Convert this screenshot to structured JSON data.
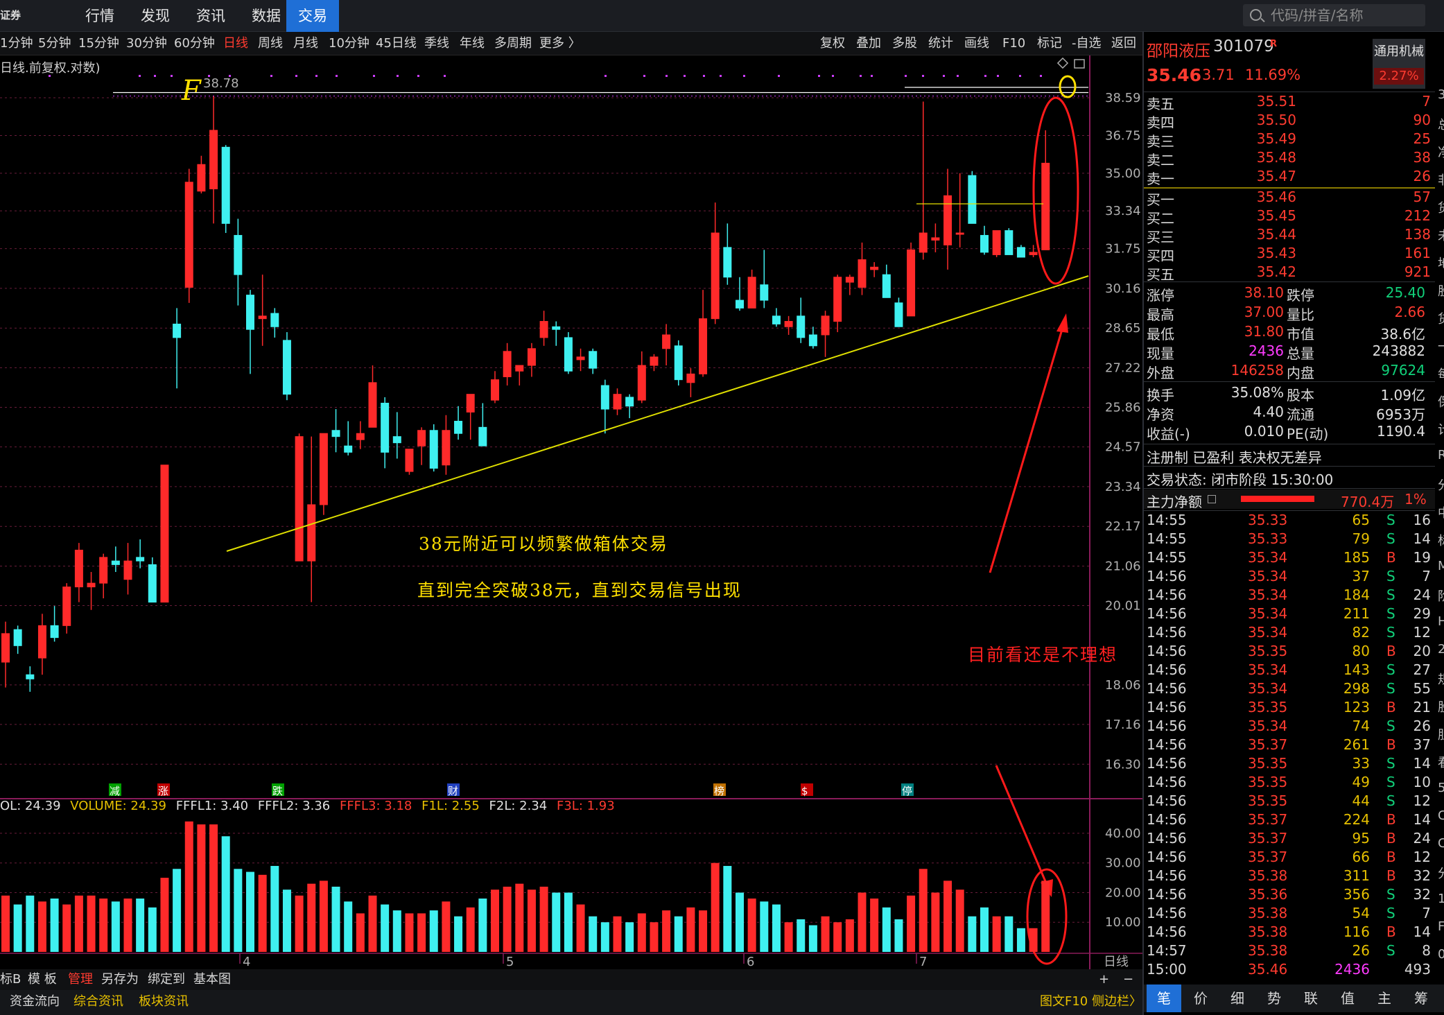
{
  "nav": {
    "logo": "证券",
    "items": [
      "行情",
      "发现",
      "资讯",
      "数据",
      "交易"
    ],
    "active": "交易",
    "search_placeholder": "代码/拼音/名称"
  },
  "toolbar": {
    "periods": [
      "1分钟",
      "5分钟",
      "15分钟",
      "30分钟",
      "60分钟",
      "日线",
      "周线",
      "月线",
      "10分钟",
      "45日线",
      "季线",
      "年线",
      "多周期",
      "更多 〉"
    ],
    "active_period": "日线",
    "tools": [
      "复权",
      "叠加",
      "多股",
      "统计",
      "画线",
      "F10",
      "标记",
      "-自选",
      "返回"
    ]
  },
  "chart": {
    "title": "日线.前复权.对数)",
    "high_label": "38.78",
    "y_ticks": [
      "38.59",
      "36.75",
      "35.00",
      "33.34",
      "31.75",
      "30.16",
      "28.65",
      "27.22",
      "25.86",
      "24.57",
      "23.34",
      "22.17",
      "21.06",
      "20.01",
      "18.06",
      "17.16",
      "16.30"
    ],
    "event_markers": [
      {
        "label": "减",
        "color": "#00a000"
      },
      {
        "label": "涨",
        "color": "#c00000"
      },
      {
        "label": "跌",
        "color": "#00a000"
      },
      {
        "label": "财",
        "color": "#2040c0"
      },
      {
        "label": "榜",
        "color": "#c07000"
      },
      {
        "label": "$",
        "color": "#c00000"
      },
      {
        "label": "停",
        "color": "#008080"
      }
    ],
    "month_labels": [
      "4",
      "5",
      "6",
      "7"
    ],
    "period_label": "日线"
  },
  "chart_data": {
    "type": "candlestick",
    "ylim": [
      16.0,
      39.5
    ],
    "y_scale": "log",
    "candles": [
      [
        18.6,
        19.6,
        18.0,
        19.3
      ],
      [
        19.4,
        19.5,
        18.8,
        19.0
      ],
      [
        18.3,
        18.5,
        17.9,
        18.2
      ],
      [
        18.7,
        19.8,
        18.3,
        19.5
      ],
      [
        19.5,
        20.0,
        19.1,
        19.2
      ],
      [
        19.5,
        20.6,
        19.3,
        20.5
      ],
      [
        20.5,
        21.7,
        20.1,
        21.5
      ],
      [
        20.5,
        20.9,
        19.9,
        20.6
      ],
      [
        20.6,
        21.4,
        20.2,
        21.3
      ],
      [
        21.2,
        21.6,
        20.9,
        21.1
      ],
      [
        20.7,
        21.7,
        20.3,
        21.2
      ],
      [
        21.3,
        21.8,
        21.0,
        21.2
      ],
      [
        21.1,
        21.3,
        20.1,
        20.1
      ],
      [
        20.1,
        24.0,
        20.1,
        24.0
      ],
      [
        28.8,
        29.4,
        26.5,
        28.3
      ],
      [
        30.2,
        35.2,
        29.6,
        34.6
      ],
      [
        34.2,
        35.8,
        34.1,
        35.4
      ],
      [
        34.3,
        38.7,
        32.8,
        37.0
      ],
      [
        36.2,
        36.3,
        32.4,
        32.8
      ],
      [
        32.3,
        33.0,
        29.5,
        30.7
      ],
      [
        29.9,
        30.1,
        27.0,
        28.6
      ],
      [
        29.0,
        30.7,
        28.0,
        29.1
      ],
      [
        29.2,
        29.4,
        28.3,
        28.7
      ],
      [
        28.2,
        28.5,
        26.1,
        26.3
      ],
      [
        21.2,
        25.0,
        21.2,
        24.9
      ],
      [
        21.2,
        24.9,
        20.1,
        22.8
      ],
      [
        22.8,
        25.0,
        22.5,
        25.0
      ],
      [
        25.1,
        25.8,
        24.4,
        24.9
      ],
      [
        24.6,
        25.4,
        24.3,
        24.4
      ],
      [
        24.8,
        25.4,
        24.5,
        25.0
      ],
      [
        25.2,
        27.3,
        25.2,
        26.7
      ],
      [
        26.0,
        26.2,
        23.9,
        24.4
      ],
      [
        24.9,
        25.7,
        24.2,
        24.7
      ],
      [
        23.8,
        24.5,
        23.7,
        24.5
      ],
      [
        24.6,
        25.2,
        24.0,
        25.1
      ],
      [
        25.1,
        25.3,
        23.8,
        23.9
      ],
      [
        24.0,
        25.6,
        23.7,
        25.1
      ],
      [
        25.4,
        25.9,
        24.8,
        25.0
      ],
      [
        25.7,
        26.3,
        24.8,
        26.3
      ],
      [
        25.2,
        26.0,
        24.6,
        24.6
      ],
      [
        26.1,
        27.1,
        26.0,
        26.8
      ],
      [
        26.9,
        28.1,
        26.6,
        27.8
      ],
      [
        27.1,
        27.3,
        26.6,
        27.3
      ],
      [
        27.3,
        28.1,
        26.9,
        27.9
      ],
      [
        28.3,
        29.3,
        28.0,
        28.9
      ],
      [
        28.7,
        28.9,
        28.0,
        28.6
      ],
      [
        28.3,
        28.5,
        27.0,
        27.1
      ],
      [
        27.5,
        27.9,
        27.1,
        27.6
      ],
      [
        27.8,
        27.9,
        27.0,
        27.2
      ],
      [
        26.6,
        26.8,
        25.0,
        25.8
      ],
      [
        25.8,
        26.5,
        25.6,
        26.3
      ],
      [
        26.2,
        26.3,
        25.5,
        25.9
      ],
      [
        26.1,
        27.8,
        26.0,
        27.3
      ],
      [
        27.3,
        27.7,
        27.1,
        27.6
      ],
      [
        27.9,
        28.8,
        27.3,
        28.4
      ],
      [
        28.0,
        28.2,
        26.6,
        26.8
      ],
      [
        26.7,
        27.2,
        26.2,
        27.0
      ],
      [
        27.0,
        30.1,
        26.9,
        29.0
      ],
      [
        29.0,
        33.7,
        28.8,
        32.4
      ],
      [
        31.8,
        32.8,
        30.3,
        30.6
      ],
      [
        29.7,
        30.6,
        29.3,
        29.4
      ],
      [
        29.4,
        30.9,
        29.4,
        30.6
      ],
      [
        30.3,
        31.7,
        29.4,
        29.7
      ],
      [
        29.1,
        29.4,
        28.7,
        28.8
      ],
      [
        28.7,
        29.1,
        28.4,
        28.9
      ],
      [
        29.1,
        29.8,
        28.1,
        28.3
      ],
      [
        28.4,
        28.7,
        27.9,
        28.0
      ],
      [
        28.4,
        29.3,
        27.6,
        29.1
      ],
      [
        28.9,
        30.7,
        28.5,
        30.6
      ],
      [
        30.4,
        30.7,
        29.9,
        30.6
      ],
      [
        30.2,
        32.0,
        29.9,
        31.3
      ],
      [
        30.9,
        31.2,
        30.6,
        31.0
      ],
      [
        30.7,
        31.1,
        29.8,
        29.8
      ],
      [
        29.6,
        29.8,
        28.7,
        28.7
      ],
      [
        29.1,
        32.0,
        29.1,
        31.7
      ],
      [
        31.6,
        38.4,
        31.3,
        32.4
      ],
      [
        32.1,
        32.8,
        31.6,
        32.2
      ],
      [
        31.9,
        35.2,
        30.9,
        34.0
      ],
      [
        32.4,
        35.0,
        31.8,
        32.4
      ],
      [
        34.9,
        35.1,
        32.8,
        32.8
      ],
      [
        32.3,
        32.7,
        31.5,
        31.6
      ],
      [
        31.5,
        32.5,
        31.4,
        32.5
      ],
      [
        32.5,
        32.6,
        31.6,
        31.5
      ],
      [
        31.8,
        31.9,
        31.5,
        31.4
      ],
      [
        31.5,
        31.9,
        31.4,
        31.6
      ],
      [
        31.7,
        37.0,
        31.7,
        35.46
      ]
    ],
    "volume": {
      "legend": {
        "VOL": "24.39",
        "VOLUME": "24.39",
        "FFFL1": "3.40",
        "FFFL2": "3.36",
        "FFFL3": "3.18",
        "F1L": "2.55",
        "F2L": "2.34",
        "F3L": "1.93"
      },
      "y_ticks": [
        "40.00",
        "30.00",
        "20.00",
        "10.00"
      ],
      "values": [
        19,
        16,
        19,
        17,
        18,
        16,
        19,
        19,
        18,
        17,
        18,
        18,
        15,
        25,
        28,
        44,
        43,
        43,
        39,
        28,
        27,
        26,
        29,
        21,
        19,
        23,
        24,
        22,
        17,
        13,
        19,
        16,
        14,
        13,
        13,
        14,
        17,
        12,
        15,
        18,
        21,
        22,
        23,
        21,
        22,
        20,
        20,
        16,
        12,
        10,
        12,
        10,
        13,
        10,
        14,
        12,
        15,
        14,
        30,
        29,
        20,
        18,
        17,
        16,
        10,
        11,
        9,
        12,
        10,
        11,
        20,
        18,
        15,
        11,
        19,
        28,
        20,
        24,
        21,
        12,
        15,
        12,
        12,
        8,
        8,
        24
      ]
    },
    "trendline": {
      "x1_price": 22.2,
      "x2_price": 30.2
    },
    "resistance_price": 38.78
  },
  "annotations": {
    "left1": "38元附近可以频繁做箱体交易",
    "left2": "直到完全突破38元，直到交易信号出现",
    "right": "目前看还是不理想",
    "handwriting_f": "F",
    "handwriting_o": "O"
  },
  "panel": {
    "name": "邵阳液压",
    "code": "301079",
    "r_badge": "R",
    "price": "35.46",
    "change": "3.71",
    "change_pct": "11.69%",
    "sector": "通用机械",
    "sector_chg": "2.27%",
    "asks": [
      {
        "label": "卖五",
        "price": "35.51",
        "vol": "7"
      },
      {
        "label": "卖四",
        "price": "35.50",
        "vol": "90"
      },
      {
        "label": "卖三",
        "price": "35.49",
        "vol": "25"
      },
      {
        "label": "卖二",
        "price": "35.48",
        "vol": "38"
      },
      {
        "label": "卖一",
        "price": "35.47",
        "vol": "26"
      }
    ],
    "bids": [
      {
        "label": "买一",
        "price": "35.46",
        "vol": "57"
      },
      {
        "label": "买二",
        "price": "35.45",
        "vol": "212"
      },
      {
        "label": "买三",
        "price": "35.44",
        "vol": "138"
      },
      {
        "label": "买四",
        "price": "35.43",
        "vol": "161"
      },
      {
        "label": "买五",
        "price": "35.42",
        "vol": "921"
      }
    ],
    "stats": {
      "zhangting_l": "涨停",
      "zhangting": "38.10",
      "dieting_l": "跌停",
      "dieting": "25.40",
      "zuigao_l": "最高",
      "zuigao": "37.00",
      "liangbi_l": "量比",
      "liangbi": "2.66",
      "zuidi_l": "最低",
      "zuidi": "31.80",
      "shizhi_l": "市值",
      "shizhi": "38.6亿",
      "xianliang_l": "现量",
      "xianliang": "2436",
      "zongliang_l": "总量",
      "zongliang": "243882",
      "waipan_l": "外盘",
      "waipan": "146258",
      "neipan_l": "内盘",
      "neipan": "97624",
      "huanshou_l": "换手",
      "huanshou": "35.08%",
      "guben_l": "股本",
      "guben": "1.09亿",
      "jingzi_l": "净资",
      "jingzi": "4.40",
      "liutong_l": "流通",
      "liutong": "6953万",
      "shouyi_l": "收益(-)",
      "shouyi": "0.010",
      "pe_l": "PE(动)",
      "pe": "1190.4"
    },
    "info1": "注册制 已盈利 表决权无差异",
    "info2": "交易状态: 闭市阶段 15:30:00",
    "main_flow_label": "主力净额",
    "main_flow": "770.4万",
    "main_flow_pct": "1%",
    "ticks": [
      {
        "t": "14:55",
        "p": "35.33",
        "v": "65",
        "d": "S",
        "n": "16"
      },
      {
        "t": "14:55",
        "p": "35.33",
        "v": "79",
        "d": "S",
        "n": "14"
      },
      {
        "t": "14:55",
        "p": "35.34",
        "v": "185",
        "d": "B",
        "n": "19"
      },
      {
        "t": "14:56",
        "p": "35.34",
        "v": "37",
        "d": "S",
        "n": "7"
      },
      {
        "t": "14:56",
        "p": "35.34",
        "v": "184",
        "d": "S",
        "n": "24"
      },
      {
        "t": "14:56",
        "p": "35.34",
        "v": "211",
        "d": "S",
        "n": "29"
      },
      {
        "t": "14:56",
        "p": "35.34",
        "v": "82",
        "d": "S",
        "n": "12"
      },
      {
        "t": "14:56",
        "p": "35.35",
        "v": "80",
        "d": "B",
        "n": "20"
      },
      {
        "t": "14:56",
        "p": "35.34",
        "v": "143",
        "d": "S",
        "n": "27"
      },
      {
        "t": "14:56",
        "p": "35.34",
        "v": "298",
        "d": "S",
        "n": "55"
      },
      {
        "t": "14:56",
        "p": "35.35",
        "v": "123",
        "d": "B",
        "n": "21"
      },
      {
        "t": "14:56",
        "p": "35.34",
        "v": "74",
        "d": "S",
        "n": "26"
      },
      {
        "t": "14:56",
        "p": "35.37",
        "v": "261",
        "d": "B",
        "n": "37"
      },
      {
        "t": "14:56",
        "p": "35.35",
        "v": "33",
        "d": "S",
        "n": "14"
      },
      {
        "t": "14:56",
        "p": "35.35",
        "v": "49",
        "d": "S",
        "n": "10"
      },
      {
        "t": "14:56",
        "p": "35.35",
        "v": "44",
        "d": "S",
        "n": "12"
      },
      {
        "t": "14:56",
        "p": "35.37",
        "v": "224",
        "d": "B",
        "n": "14"
      },
      {
        "t": "14:56",
        "p": "35.37",
        "v": "95",
        "d": "B",
        "n": "24"
      },
      {
        "t": "14:56",
        "p": "35.37",
        "v": "66",
        "d": "B",
        "n": "12"
      },
      {
        "t": "14:56",
        "p": "35.38",
        "v": "311",
        "d": "B",
        "n": "32"
      },
      {
        "t": "14:56",
        "p": "35.36",
        "v": "356",
        "d": "S",
        "n": "32"
      },
      {
        "t": "14:56",
        "p": "35.38",
        "v": "54",
        "d": "S",
        "n": "7"
      },
      {
        "t": "14:56",
        "p": "35.38",
        "v": "116",
        "d": "B",
        "n": "14"
      },
      {
        "t": "14:57",
        "p": "35.38",
        "v": "26",
        "d": "S",
        "n": "8"
      },
      {
        "t": "15:00",
        "p": "35.46",
        "v": "2436",
        "d": "",
        "n": "493"
      }
    ],
    "edge_chars": [
      "3",
      "总",
      "净",
      "非",
      "货",
      "未",
      "地",
      "股",
      "货",
      "一",
      "每",
      "保",
      "计",
      "R",
      "分",
      "中",
      "标",
      "M",
      "阶",
      "H",
      "2",
      "规",
      "股",
      "胆",
      "看",
      "5",
      "C",
      "C",
      "分",
      "1",
      "F",
      "0"
    ],
    "tabs": [
      "笔",
      "价",
      "细",
      "势",
      "联",
      "值",
      "主",
      "筹"
    ],
    "active_tab": "笔"
  },
  "bottom": {
    "row1": [
      "标B",
      "模 板",
      "管理",
      "另存为",
      "绑定到",
      "基本图"
    ],
    "row2": [
      "资金流向",
      "综合资讯",
      "板块资讯"
    ],
    "right1": [
      "+",
      "−"
    ],
    "right2": "图文F10 侧边栏〉"
  }
}
